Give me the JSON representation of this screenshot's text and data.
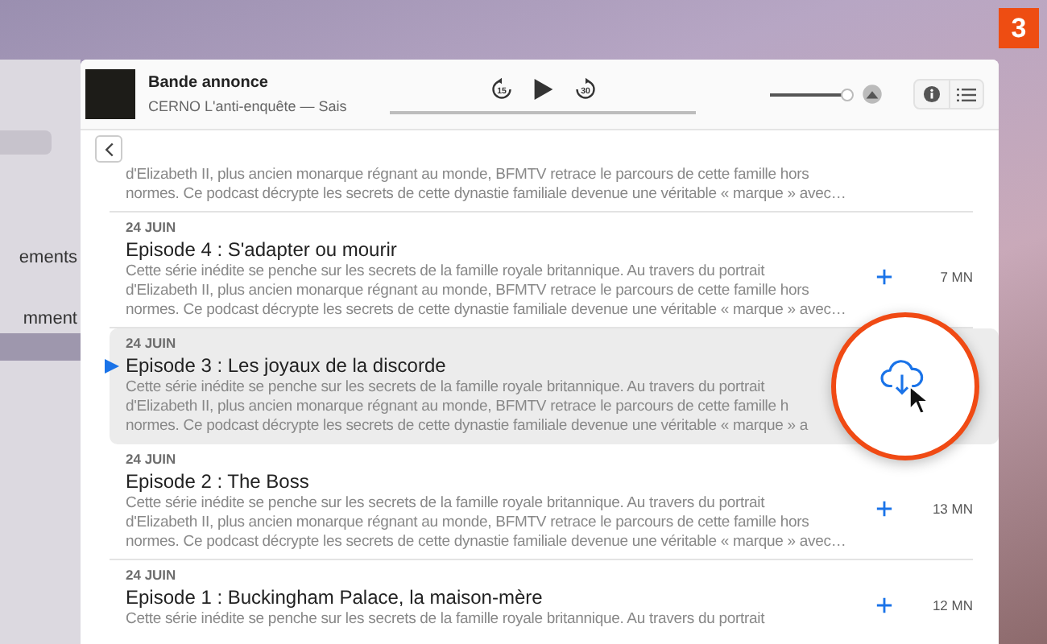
{
  "step_badge": "3",
  "sidebar": {
    "items": [
      {
        "label": "ements",
        "selected": false
      },
      {
        "label": "mment",
        "selected": false
      },
      {
        "selected": true
      }
    ]
  },
  "player": {
    "title": "Bande annonce",
    "subtitle": "CERNO L'anti-enquête — Sais",
    "skip_back": "15",
    "skip_forward": "30",
    "volume": {
      "level": 1
    }
  },
  "episodes": [
    {
      "description_lines": [
        "d'Elizabeth II, plus ancien monarque régnant au monde, BFMTV retrace le parcours de cette famille hors",
        "normes. Ce podcast décrypte les secrets de cette dynastie familiale devenue une véritable « marque » avec…"
      ],
      "playing": false,
      "highlighted": false
    },
    {
      "date": "24 JUIN",
      "title": "Episode 4 : S'adapter ou mourir",
      "description_lines": [
        "Cette série inédite se penche sur les secrets de la famille royale britannique. Au travers du portrait",
        "d'Elizabeth II, plus ancien monarque régnant au monde, BFMTV retrace le parcours de cette famille hors",
        "normes. Ce podcast décrypte les secrets de cette dynastie familiale devenue une véritable « marque » avec…"
      ],
      "duration": "7 MN",
      "kind": "add",
      "playing": false,
      "highlighted": false
    },
    {
      "date": "24 JUIN",
      "title": "Episode 3 : Les joyaux de la discorde",
      "description_lines": [
        "Cette série inédite se penche sur les secrets de la famille royale britannique. Au travers du portrait",
        "d'Elizabeth II, plus ancien monarque régnant au monde, BFMTV retrace le parcours de cette famille h",
        "normes. Ce podcast décrypte les secrets de cette dynastie familiale devenue une véritable « marque » a"
      ],
      "kind": "download",
      "playing": true,
      "highlighted": true
    },
    {
      "date": "24 JUIN",
      "title": "Episode 2 : The Boss",
      "description_lines": [
        "Cette série inédite se penche sur les secrets de la famille royale britannique. Au travers du portrait",
        "d'Elizabeth II, plus ancien monarque régnant au monde, BFMTV retrace le parcours de cette famille hors",
        "normes. Ce podcast décrypte les secrets de cette dynastie familiale devenue une véritable « marque » avec…"
      ],
      "duration": "13 MN",
      "kind": "add",
      "playing": false,
      "highlighted": false
    },
    {
      "date": "24 JUIN",
      "title": "Episode 1 : Buckingham Palace, la maison-mère",
      "description_lines": [
        "Cette série inédite se penche sur les secrets de la famille royale britannique. Au travers du portrait"
      ],
      "duration": "12 MN",
      "kind": "add",
      "playing": false,
      "highlighted": false
    }
  ]
}
